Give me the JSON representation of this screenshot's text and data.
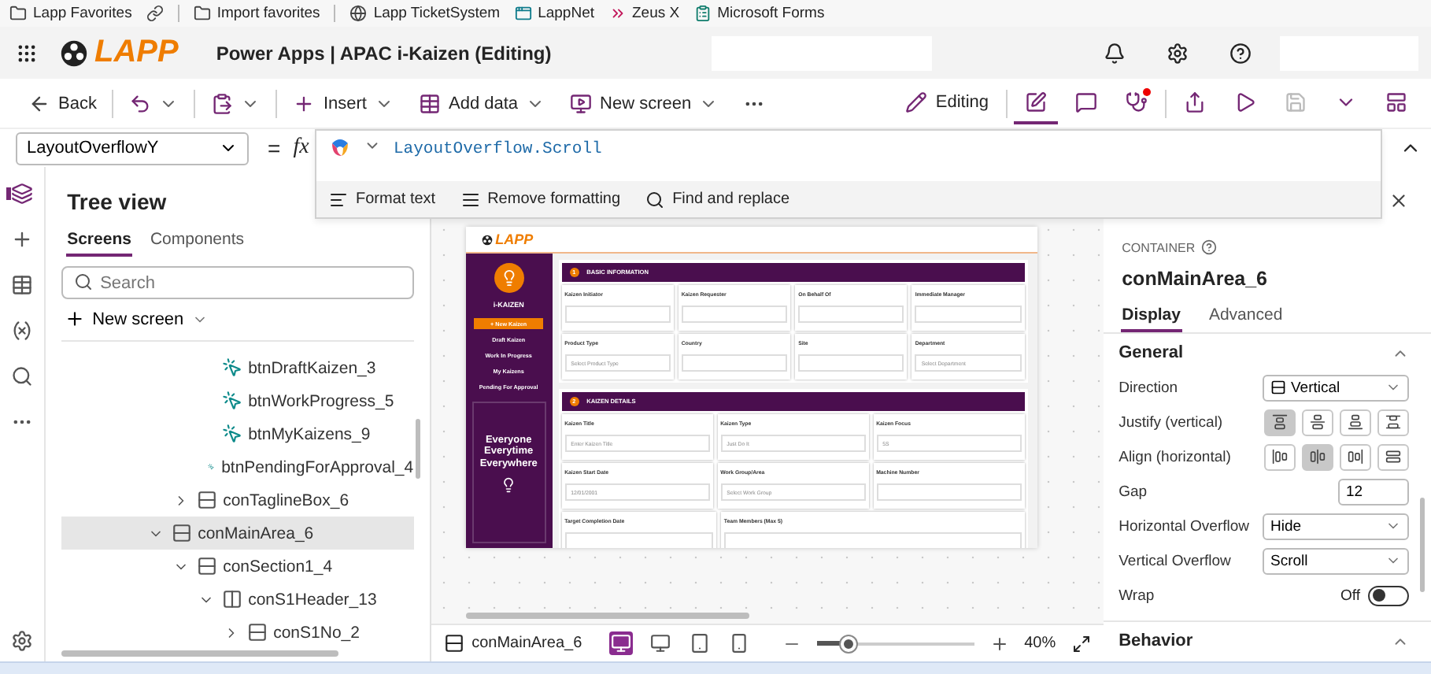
{
  "bookmarks": [
    {
      "kind": "folder",
      "label": "Lapp Favorites",
      "separated": false
    },
    {
      "kind": "link",
      "separated": false
    },
    {
      "kind": "folder",
      "label": "Import favorites",
      "separated": true
    },
    {
      "kind": "globe",
      "label": "Lapp TicketSystem",
      "separated": true
    },
    {
      "kind": "app",
      "label": "LappNet",
      "separated": false
    },
    {
      "kind": "zeus",
      "label": "Zeus X",
      "separated": false
    },
    {
      "kind": "forms",
      "label": "Microsoft Forms",
      "separated": false
    }
  ],
  "header": {
    "logo": "LAPP",
    "title": "Power Apps | APAC i-Kaizen (Editing)"
  },
  "commands": [
    {
      "kind": "back",
      "label": "Back",
      "menu": false
    },
    {
      "kind": "undo",
      "menu": true
    },
    {
      "kind": "paste",
      "menu": true
    },
    {
      "kind": "insert",
      "label": "Insert",
      "menu": true
    },
    {
      "kind": "data",
      "label": "Add data",
      "menu": true
    },
    {
      "kind": "screen",
      "label": "New screen",
      "menu": true
    },
    {
      "kind": "more",
      "menu": false
    }
  ],
  "tools": [
    {
      "kind": "editing",
      "label": "Editing"
    },
    {
      "kind": "copilot",
      "selected": true,
      "alert": false
    },
    {
      "kind": "comments",
      "selected": false,
      "alert": false
    },
    {
      "kind": "checker",
      "selected": false,
      "alert": true
    },
    {
      "kind": "share"
    },
    {
      "kind": "preview"
    },
    {
      "kind": "save",
      "disabled": true
    },
    {
      "kind": "menu"
    },
    {
      "kind": "publish"
    }
  ],
  "formula": {
    "property": "LayoutOverflowY",
    "equals": "=",
    "fx": "fx",
    "value": "LayoutOverflow.Scroll",
    "actions": [
      {
        "kind": "format",
        "label": "Format text"
      },
      {
        "kind": "remove",
        "label": "Remove formatting"
      },
      {
        "kind": "find",
        "label": "Find and replace"
      }
    ]
  },
  "rail": [
    {
      "kind": "tree",
      "selected": true
    },
    {
      "kind": "insert",
      "selected": false
    },
    {
      "kind": "data",
      "selected": false
    },
    {
      "kind": "variables",
      "selected": false
    },
    {
      "kind": "search",
      "selected": false
    },
    {
      "kind": "more",
      "selected": false
    },
    {
      "kind": "settings",
      "selected": false
    }
  ],
  "tree": {
    "title": "Tree view",
    "tabs": [
      {
        "label": "Screens",
        "selected": true
      },
      {
        "label": "Components",
        "selected": false
      }
    ],
    "search": {
      "placeholder": "Search"
    },
    "new_screen": "New screen",
    "nodes": [
      {
        "children": [
          {
            "children": [
              {
                "kind": "button",
                "name": "btnDraftKaizen_3",
                "selected": false
              },
              {
                "kind": "button",
                "name": "btnWorkProgress_5",
                "selected": false
              },
              {
                "kind": "button",
                "name": "btnMyKaizens_9",
                "selected": false
              },
              {
                "kind": "button",
                "name": "btnPendingForApproval_4",
                "selected": false
              }
            ]
          },
          {
            "kind": "container",
            "name": "conTaglineBox_6",
            "expanded": false,
            "selected": false
          }
        ]
      },
      {
        "kind": "container",
        "name": "conMainArea_6",
        "expanded": true,
        "selected": true,
        "children": [
          {
            "kind": "container",
            "name": "conSection1_4",
            "expanded": true,
            "selected": false,
            "children": [
              {
                "kind": "row",
                "name": "conS1Header_13",
                "expanded": true,
                "selected": false,
                "children": [
                  {
                    "kind": "container",
                    "name": "conS1No_2",
                    "expanded": false,
                    "selected": false
                  }
                ]
              }
            ]
          }
        ]
      }
    ]
  },
  "preview": {
    "logo": "LAPP",
    "app_title": "i-KAIZEN",
    "menu": [
      {
        "label": "+ New Kaizen",
        "selected": true
      },
      {
        "label": "Draft Kaizen",
        "selected": false
      },
      {
        "label": "Work In Progress",
        "selected": false
      },
      {
        "label": "My Kaizens",
        "selected": false
      },
      {
        "label": "Pending For Approval",
        "selected": false
      }
    ],
    "tagline": [
      "Everyone",
      "Everytime",
      "Everywhere"
    ],
    "sections": [
      {
        "number": "1",
        "title": "BASIC INFORMATION",
        "rows": [
          [
            {
              "label": "Kaizen Initiator"
            },
            {
              "label": "Kaizen Requester"
            },
            {
              "label": "On Behalf Of"
            },
            {
              "label": "Immediate Manager"
            }
          ],
          [
            {
              "label": "Product Type",
              "placeholder": "Select Product Type"
            },
            {
              "label": "Country"
            },
            {
              "label": "Site"
            },
            {
              "label": "Department",
              "placeholder": "Select Department"
            }
          ]
        ]
      },
      {
        "number": "2",
        "title": "KAIZEN DETAILS",
        "rows": [
          [
            {
              "label": "Kaizen Title",
              "placeholder": "Enter Kaizen Title"
            },
            {
              "label": "Kaizen Type",
              "placeholder": "Just Do It"
            },
            {
              "label": "Kaizen Focus",
              "placeholder": "5S"
            }
          ],
          [
            {
              "label": "Kaizen Start Date",
              "placeholder": "12/01/2001"
            },
            {
              "label": "Work Group/Area",
              "placeholder": "Select Work Group"
            },
            {
              "label": "Machine Number"
            }
          ],
          [
            {
              "label": "Target Completion Date",
              "wide": false
            },
            {
              "label": "Team Members (Max 5)",
              "wide": true
            }
          ]
        ]
      }
    ]
  },
  "properties": {
    "type": "CONTAINER",
    "name": "conMainArea_6",
    "tabs": [
      {
        "label": "Display",
        "selected": true
      },
      {
        "label": "Advanced",
        "selected": false
      }
    ],
    "sections": [
      {
        "title": "General",
        "expanded": true,
        "rows": [
          {
            "kind": "dropdown",
            "label": "Direction",
            "value": "Vertical",
            "icon": true
          },
          {
            "kind": "options",
            "label": "Justify (vertical)",
            "options": [
              {
                "kind": "start",
                "selected": true
              },
              {
                "kind": "center",
                "selected": false
              },
              {
                "kind": "end",
                "selected": false
              },
              {
                "kind": "between",
                "selected": false
              }
            ]
          },
          {
            "kind": "options",
            "label": "Align (horizontal)",
            "options": [
              {
                "kind": "hstart",
                "selected": false
              },
              {
                "kind": "hcenter",
                "selected": true
              },
              {
                "kind": "hend",
                "selected": false
              },
              {
                "kind": "stretch",
                "selected": false
              }
            ]
          },
          {
            "kind": "number",
            "label": "Gap",
            "value": "12"
          },
          {
            "kind": "dropdown",
            "label": "Horizontal Overflow",
            "value": "Hide",
            "icon": false
          },
          {
            "kind": "dropdown",
            "label": "Vertical Overflow",
            "value": "Scroll",
            "icon": false
          },
          {
            "kind": "toggle",
            "label": "Wrap",
            "value": "Off",
            "on": false
          }
        ]
      },
      {
        "title": "Behavior",
        "expanded": true
      }
    ]
  },
  "status": {
    "selection": "conMainArea_6",
    "devices": [
      {
        "kind": "app",
        "selected": true
      },
      {
        "kind": "desktop",
        "selected": false
      },
      {
        "kind": "tablet",
        "selected": false
      },
      {
        "kind": "phone",
        "selected": false
      }
    ],
    "zoom": {
      "level": 0.2,
      "reading": "40%"
    }
  }
}
